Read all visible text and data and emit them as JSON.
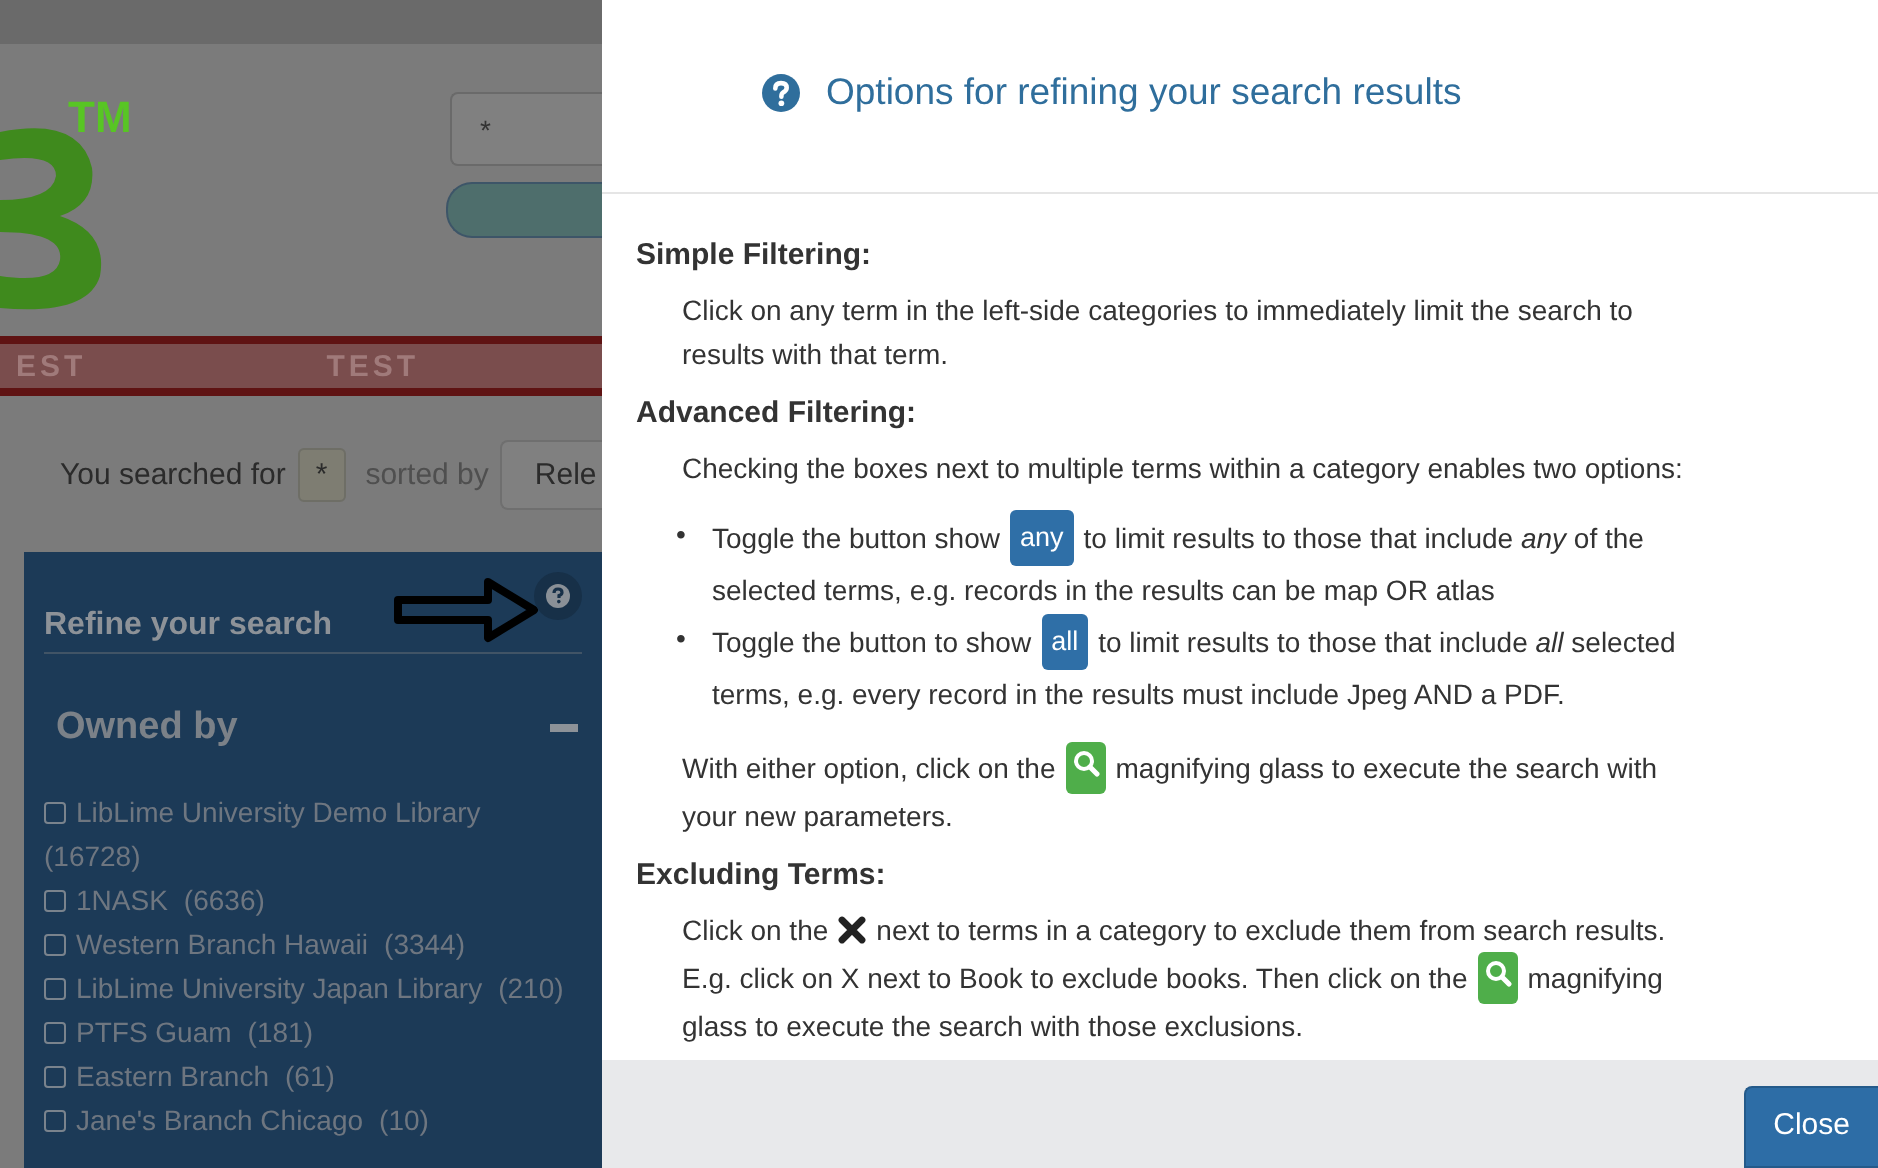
{
  "background_page": {
    "logo": {
      "mark": "TM"
    },
    "search_field": {
      "value": "*"
    },
    "banner": [
      "EST",
      "TEST"
    ],
    "search_summary": {
      "prefix": "You searched for",
      "query": "*",
      "sorted_label": "sorted by",
      "sort_select": "Rele"
    },
    "sidebar": {
      "title": "Refine your search",
      "section": "Owned by",
      "items": [
        {
          "label": "LibLime University Demo Library",
          "count": "(16728)",
          "checked": false
        },
        {
          "label": "1NASK",
          "count": "(6636)",
          "checked": false
        },
        {
          "label": "Western Branch Hawaii",
          "count": "(3344)",
          "checked": false
        },
        {
          "label": "LibLime University Japan Library",
          "count": "(210)",
          "checked": false
        },
        {
          "label": "PTFS Guam",
          "count": "(181)",
          "checked": false
        },
        {
          "label": "Eastern Branch",
          "count": "(61)",
          "checked": false
        },
        {
          "label": "Jane's Branch Chicago",
          "count": "(10)",
          "checked": false
        }
      ]
    }
  },
  "modal": {
    "title": "Options for refining your search results",
    "sections": [
      {
        "heading": "Simple Filtering:",
        "blocks": [
          {
            "kind": "paragraph",
            "lines": [
              [
                {
                  "kind": "text",
                  "text": "Click on any term in the left-side categories to immediately limit the search to"
                }
              ],
              [
                {
                  "kind": "text",
                  "text": "results with that term."
                }
              ]
            ]
          }
        ]
      },
      {
        "heading": "Advanced Filtering:",
        "blocks": [
          {
            "kind": "paragraph",
            "lines": [
              [
                {
                  "kind": "text",
                  "text": "Checking the boxes next to multiple terms within a category enables two options:"
                }
              ]
            ]
          },
          {
            "kind": "list",
            "items": [
              {
                "marker": "•",
                "lines": [
                  [
                    {
                      "kind": "text",
                      "text": "Toggle the button show"
                    },
                    {
                      "kind": "toggle",
                      "text": "any"
                    },
                    {
                      "kind": "text",
                      "text": "to limit results to those that include *any* of the"
                    }
                  ],
                  [
                    {
                      "kind": "text",
                      "text": "selected terms, e.g. records in the results can be map OR atlas"
                    }
                  ]
                ]
              },
              {
                "marker": "•",
                "lines": [
                  [
                    {
                      "kind": "text",
                      "text": "Toggle the button to show"
                    },
                    {
                      "kind": "toggle",
                      "text": "all"
                    },
                    {
                      "kind": "text",
                      "text": "to limit results to those that include *all* selected"
                    }
                  ],
                  [
                    {
                      "kind": "text",
                      "text": "terms, e.g. every record in the results must include Jpeg AND a PDF."
                    }
                  ]
                ]
              }
            ]
          },
          {
            "kind": "paragraph",
            "lines": [
              [
                {
                  "kind": "text",
                  "text": "With either option, click on the"
                },
                {
                  "kind": "search"
                },
                {
                  "kind": "text",
                  "text": "magnifying glass to execute the search with"
                }
              ],
              [
                {
                  "kind": "text",
                  "text": "your new parameters."
                }
              ]
            ]
          }
        ]
      },
      {
        "heading": "Excluding Terms:",
        "blocks": [
          {
            "kind": "paragraph",
            "lines": [
              [
                {
                  "kind": "text",
                  "text": "Click on the"
                },
                {
                  "kind": "remove"
                },
                {
                  "kind": "text",
                  "text": "next to terms in a category to exclude them from search results."
                }
              ],
              [
                {
                  "kind": "text",
                  "text": "E.g. click on X next to Book to exclude books. Then click on the"
                },
                {
                  "kind": "search"
                },
                {
                  "kind": "text",
                  "text": "magnifying"
                }
              ],
              [
                {
                  "kind": "text",
                  "text": "glass to execute the search with those exclusions."
                }
              ]
            ]
          }
        ]
      }
    ],
    "close_button": "Close"
  }
}
